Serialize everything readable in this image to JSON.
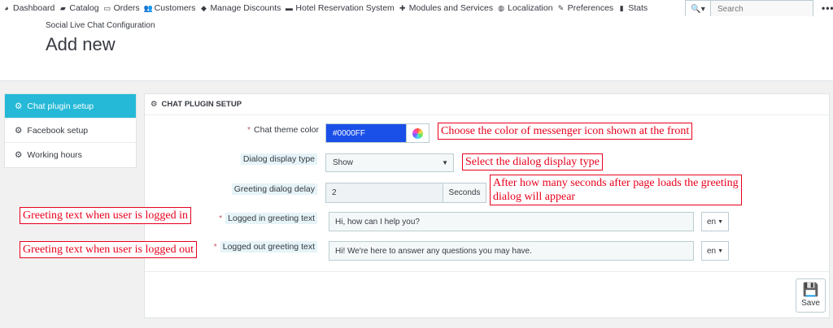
{
  "nav": {
    "items": [
      {
        "label": "Dashboard",
        "icon": "dashboard-icon",
        "glyph": "◕"
      },
      {
        "label": "Catalog",
        "icon": "book-icon",
        "glyph": "▰"
      },
      {
        "label": "Orders",
        "icon": "credit-card-icon",
        "glyph": "▭"
      },
      {
        "label": "Customers",
        "icon": "users-icon",
        "glyph": "👥"
      },
      {
        "label": "Manage Discounts",
        "icon": "tag-icon",
        "glyph": "◆"
      },
      {
        "label": "Hotel Reservation System",
        "icon": "bed-icon",
        "glyph": "▬"
      },
      {
        "label": "Modules and Services",
        "icon": "puzzle-icon",
        "glyph": "✚"
      },
      {
        "label": "Localization",
        "icon": "globe-icon",
        "glyph": "◍"
      },
      {
        "label": "Preferences",
        "icon": "wrench-icon",
        "glyph": "✎"
      },
      {
        "label": "Stats",
        "icon": "bar-chart-icon",
        "glyph": "▮"
      }
    ],
    "search_placeholder": "Search",
    "more_label": "•••"
  },
  "header": {
    "breadcrumb": "Social Live Chat Configuration",
    "title": "Add new"
  },
  "tabs": [
    {
      "label": "Chat plugin setup",
      "active": true
    },
    {
      "label": "Facebook setup",
      "active": false
    },
    {
      "label": "Working hours",
      "active": false
    }
  ],
  "panel": {
    "title": "CHAT PLUGIN SETUP",
    "fields": {
      "theme_color": {
        "label": "Chat theme color",
        "value": "#0000FF",
        "color": "#1a4fe8"
      },
      "dialog_type": {
        "label": "Dialog display type",
        "value": "Show"
      },
      "greeting_delay": {
        "label": "Greeting dialog delay",
        "value": "2",
        "unit": "Seconds"
      },
      "logged_in": {
        "label": "Logged in greeting text",
        "value": "Hi, how can I help you?",
        "lang": "en"
      },
      "logged_out": {
        "label": "Logged out greeting text",
        "value": "Hi! We're here to answer any questions you may have.",
        "lang": "en"
      }
    },
    "save_label": "Save"
  },
  "annotations": {
    "color": "Choose the color of messenger icon shown at the front",
    "dialog": "Select the dialog display type",
    "delay_line1": "After how many seconds after page loads the greeting",
    "delay_line2": "dialog will appear",
    "logged_in": "Greeting text when user is logged in",
    "logged_out": "Greeting text when user is logged out"
  },
  "colors": {
    "accent": "#25b9d7",
    "annotation": "#e8001c",
    "required": "#c05c67"
  }
}
